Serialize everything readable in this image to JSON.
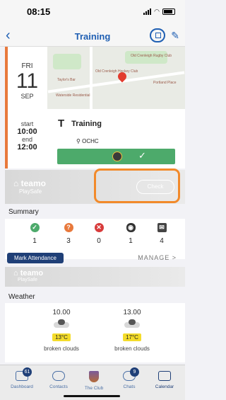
{
  "status_bar": {
    "time": "08:15"
  },
  "nav": {
    "title": "Training"
  },
  "event": {
    "weekday": "FRI",
    "day": "11",
    "month": "SEP",
    "start_label": "start",
    "start_time": "10:00",
    "end_label": "end",
    "end_time": "12:00",
    "type_letter": "T",
    "name": "Training",
    "club": "OCHC"
  },
  "map": {
    "labels": [
      "Old Crenleigh Rugby Club",
      "Old Crenleigh Hockey Club",
      "Portland Place",
      "Taylor's Bar",
      "Waterside Residential"
    ]
  },
  "teamo_banner": {
    "brand": "teamo",
    "sub": "PlaySafe",
    "check_label": "Check"
  },
  "summary": {
    "title": "Summary",
    "counts": [
      {
        "icon": "check-icon",
        "value": "1",
        "color": "#4daa6b"
      },
      {
        "icon": "question-icon",
        "value": "3",
        "color": "#e8793c"
      },
      {
        "icon": "cross-icon",
        "value": "0",
        "color": "#d83b3b"
      },
      {
        "icon": "eye-icon",
        "value": "1",
        "color": "#333333"
      },
      {
        "icon": "envelope-icon",
        "value": "4",
        "color": "#333333"
      }
    ],
    "mark_attendance": "Mark Attendance",
    "manage": "MANAGE >"
  },
  "teamo_banner2": {
    "brand": "teamo",
    "sub": "PlaySafe"
  },
  "weather": {
    "title": "Weather",
    "items": [
      {
        "time": "10.00",
        "temp": "13°C",
        "desc": "broken clouds"
      },
      {
        "time": "13.00",
        "temp": "17°C",
        "desc": "broken clouds"
      }
    ]
  },
  "tabs": [
    {
      "label": "Dashboard",
      "badge": "61"
    },
    {
      "label": "Contacts"
    },
    {
      "label": "The Club"
    },
    {
      "label": "Chats",
      "badge": "9"
    },
    {
      "label": "Calendar"
    }
  ]
}
